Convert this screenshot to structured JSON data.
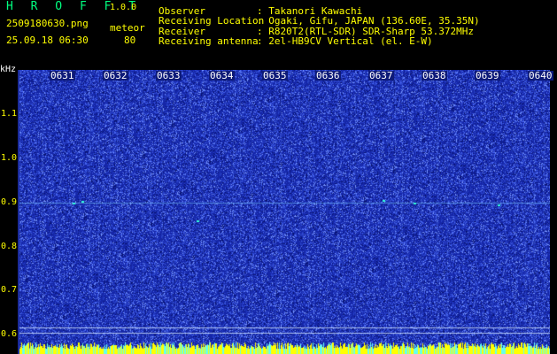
{
  "header": {
    "app_name": "H R O F F T",
    "version": "1.0.0",
    "filename": "2509180630.png",
    "timestamp": "25.09.18 06:30",
    "mode_label": "meteor",
    "mode_count": "80",
    "info": [
      {
        "key": "Observer",
        "value": ": Takanori Kawachi"
      },
      {
        "key": "Receiving Location",
        "value": ": Ogaki, Gifu, JAPAN (136.60E, 35.35N)"
      },
      {
        "key": "Receiver",
        "value": ": R820T2(RTL-SDR) SDR-Sharp 53.372MHz"
      },
      {
        "key": "Receiving antenna",
        "value": ": 2el-HB9CV Vertical (el. E-W)"
      }
    ]
  },
  "spectrogram": {
    "y_unit": "kHz",
    "y_ticks": [
      "1.1",
      "1.0",
      "0.9",
      "0.8",
      "0.7",
      "0.6"
    ],
    "x_ticks": [
      "0631",
      "0632",
      "0633",
      "0634",
      "0635",
      "0636",
      "0637",
      "0638",
      "0639",
      "0640"
    ],
    "colors": {
      "background": "#1526a8",
      "noise_light": "#5a7cff",
      "signal": "#33ffdd",
      "baseline": "#ffff00"
    }
  }
}
